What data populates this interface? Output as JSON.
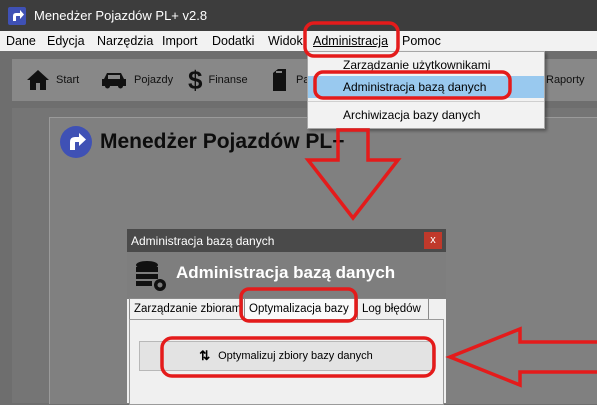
{
  "window": {
    "title": "Menedżer Pojazdów PL+   v2.8"
  },
  "menubar": {
    "items": [
      {
        "label": "Dane"
      },
      {
        "label": "Edycja"
      },
      {
        "label": "Narzędzia"
      },
      {
        "label": "Import"
      },
      {
        "label": "Dodatki"
      },
      {
        "label": "Widok"
      },
      {
        "label": "Administracja"
      },
      {
        "label": "Pomoc"
      }
    ]
  },
  "toolbar": {
    "items": [
      {
        "label": "Start",
        "icon": "home-icon"
      },
      {
        "label": "Pojazdy",
        "icon": "car-icon"
      },
      {
        "label": "Finanse",
        "icon": "dollar-icon"
      },
      {
        "label": "Pa",
        "icon": "fuel-can-icon"
      },
      {
        "label": "Raporty",
        "icon": "report-icon"
      }
    ]
  },
  "dropdown": {
    "items": [
      {
        "label": "Zarządzanie użytkownikami"
      },
      {
        "label": "Administracja bazą danych"
      },
      {
        "label": "Archiwizacja bazy danych"
      }
    ],
    "highlight_color": "#99c9ef"
  },
  "main": {
    "brand_title": "Menedżer Pojazdów PL+"
  },
  "dialog": {
    "title": "Administracja bazą danych",
    "close_label": "x",
    "heading": "Administracja bazą danych",
    "tabs": [
      {
        "label": "Zarządzanie zbiorami"
      },
      {
        "label": "Optymalizacja bazy"
      },
      {
        "label": "Log błędów"
      }
    ],
    "action_button": "Optymalizuj zbiory bazy danych"
  },
  "colors": {
    "annotation_red": "#e41b1b",
    "app_accent": "#3f51b5",
    "titlebar": "#3d3d3d"
  }
}
